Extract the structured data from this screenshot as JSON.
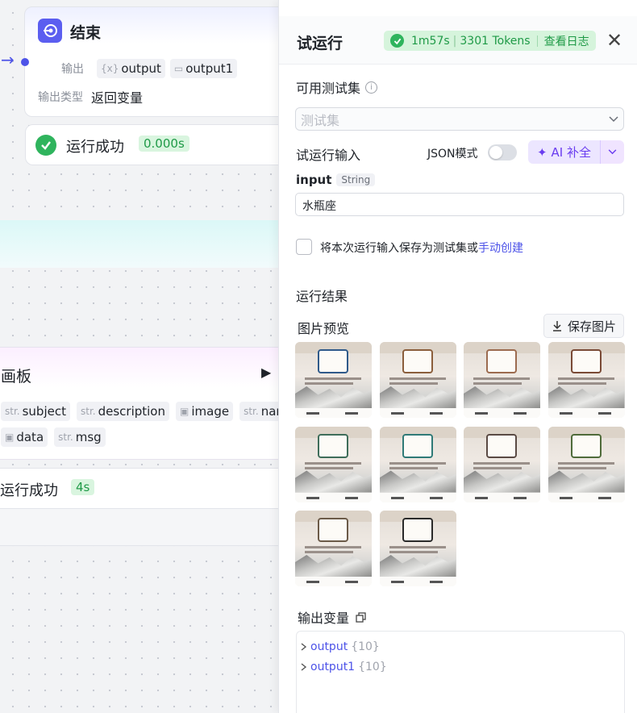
{
  "end_node": {
    "title": "结束",
    "output_label": "输出",
    "outputs": [
      {
        "type_glyph": "{x}",
        "name": "output"
      },
      {
        "type_glyph": "▭",
        "name": "output1"
      }
    ],
    "output_type_label": "输出类型",
    "output_type_value": "返回变量"
  },
  "end_status": {
    "text": "运行成功",
    "time": "0.000s"
  },
  "canvas_node": {
    "title": "画板",
    "vars_row1": [
      {
        "type": "str.",
        "name": "subject"
      },
      {
        "type": "str.",
        "name": "description"
      },
      {
        "type": "img",
        "name": "image"
      },
      {
        "type": "str.",
        "name": "nam"
      }
    ],
    "vars_row2": [
      {
        "type": "img",
        "name": "data"
      },
      {
        "type": "str.",
        "name": "msg"
      }
    ]
  },
  "canvas_status": {
    "text": "运行成功",
    "time": "4s"
  },
  "panel": {
    "title": "试运行",
    "status_time": "1m57s",
    "status_tokens": "3301 Tokens",
    "view_log": "查看日志",
    "testset_label": "可用测试集",
    "testset_placeholder": "测试集",
    "run_input_label": "试运行输入",
    "json_mode_label": "JSON模式",
    "ai_button": "AI 补全",
    "input_name": "input",
    "input_type": "String",
    "input_value": "水瓶座",
    "save_text": "将本次运行输入保存为测试集或",
    "manual_create": "手动创建",
    "result_label": "运行结果",
    "image_preview_label": "图片预览",
    "save_image_button": "保存图片",
    "image_count": 10,
    "output_vars_label": "输出变量",
    "output_vars": [
      {
        "name": "output",
        "count": "{10}"
      },
      {
        "name": "output1",
        "count": "{10}"
      }
    ]
  },
  "icons": {
    "end": "stop-circle-icon",
    "check": "check-circle-icon",
    "close": "close-icon",
    "info": "info-icon",
    "chevron": "chevron-down-icon",
    "sparkle": "sparkle-icon",
    "download": "download-icon",
    "copy": "copy-icon",
    "run": "play-icon"
  },
  "colors": {
    "accent": "#4d53e8",
    "success": "#2fb45d",
    "success_bg": "#d6f4dc",
    "ai": "#6a3df0"
  }
}
